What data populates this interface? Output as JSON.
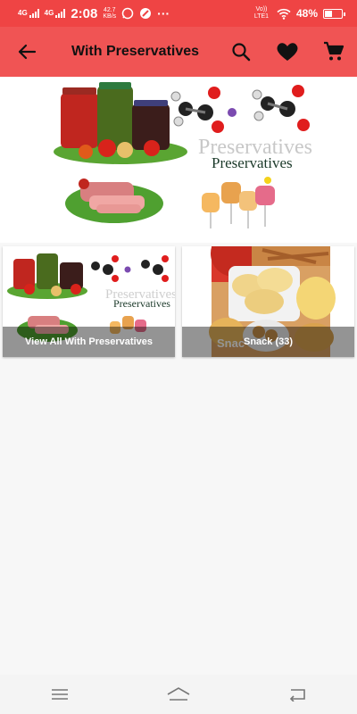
{
  "status_bar": {
    "network1": "4G",
    "network2": "4G",
    "time": "2:08",
    "speed_value": "42.7",
    "speed_unit": "KB/s",
    "carrier": "Vo)) LTE1",
    "battery": "48%",
    "battery_level": 0.48,
    "more": "···"
  },
  "app_bar": {
    "title": "With Preservatives",
    "icons": [
      "arrow-back-icon",
      "search-icon",
      "heart-icon",
      "cart-icon"
    ]
  },
  "banner": {
    "word_watermark": "Preservatives",
    "word_main": "Preservatives"
  },
  "categories": [
    {
      "label": "View All With Preservatives",
      "image_text": "Preservatives",
      "image_watermark": "Preservatives"
    },
    {
      "label": "Snack (33)",
      "image_text": "Snac"
    }
  ],
  "nav_bar": {
    "icons": [
      "menu-icon",
      "home-icon",
      "back-icon"
    ]
  },
  "colors": {
    "status_bar": "#ef4444",
    "app_bar": "#f05454",
    "background": "#f7f7f7"
  }
}
